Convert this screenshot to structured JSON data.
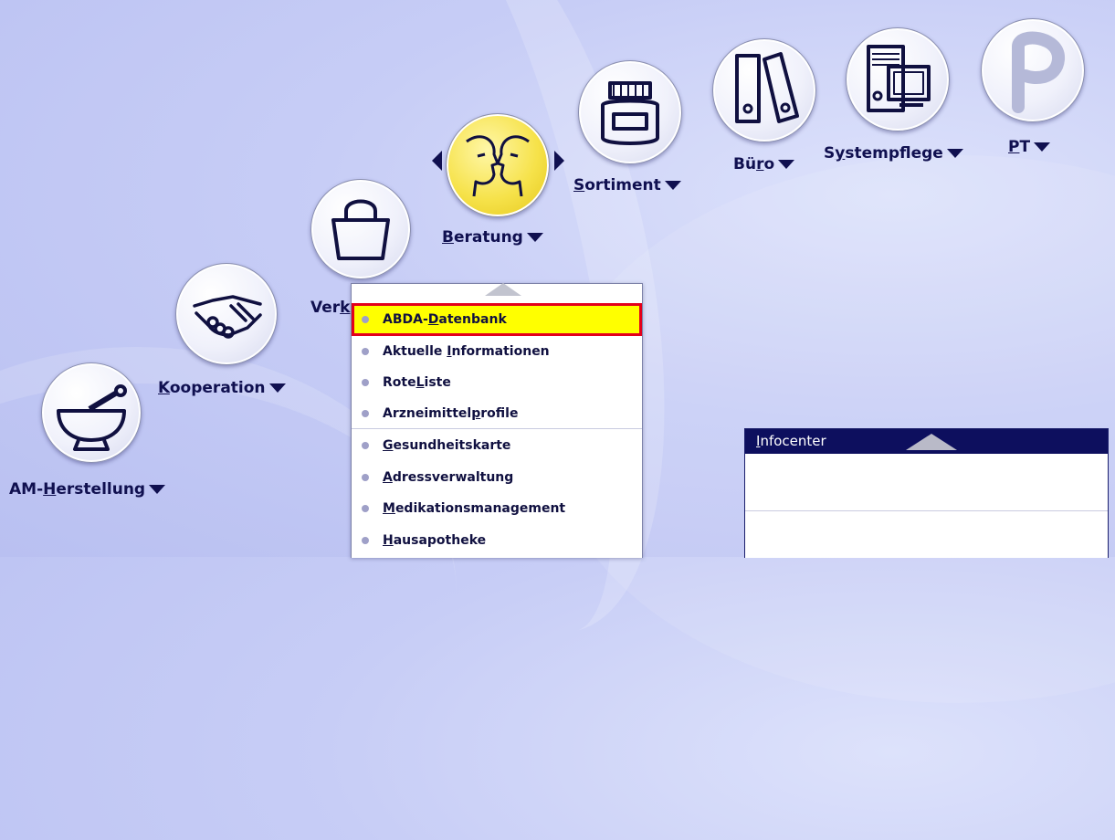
{
  "modules": [
    {
      "id": "am-herstellung",
      "before": "AM-",
      "key": "H",
      "after": "erstellung",
      "icon": "mortar-pestle-icon"
    },
    {
      "id": "kooperation",
      "before": "",
      "key": "K",
      "after": "ooperation",
      "icon": "handshake-icon"
    },
    {
      "id": "verkauf",
      "before": "Ver",
      "key": "k",
      "after": "",
      "icon": "shopping-bag-icon"
    },
    {
      "id": "beratung",
      "before": "",
      "key": "B",
      "after": "eratung",
      "icon": "faces-icon"
    },
    {
      "id": "sortiment",
      "before": "",
      "key": "S",
      "after": "ortiment",
      "icon": "jar-icon"
    },
    {
      "id": "buero",
      "before": "Bü",
      "key": "r",
      "after": "o",
      "icon": "binders-icon"
    },
    {
      "id": "systempflege",
      "before": "S",
      "key": "y",
      "after": "stempflege",
      "icon": "computer-icon"
    },
    {
      "id": "pt",
      "before": "",
      "key": "P",
      "after": "T",
      "icon": "p-logo-icon"
    }
  ],
  "dropdown": {
    "items": [
      {
        "before": "ABDA-",
        "key": "D",
        "after": "atenbank",
        "highlighted": true
      },
      {
        "before": "Aktuelle ",
        "key": "I",
        "after": "nformationen"
      },
      {
        "before": "Rote",
        "key": "L",
        "after": "iste"
      },
      {
        "before": "Arzneimittel",
        "key": "p",
        "after": "rofile"
      },
      {
        "before": "",
        "key": "G",
        "after": "esundheitskarte"
      },
      {
        "before": "",
        "key": "A",
        "after": "dressverwaltung"
      },
      {
        "before": "",
        "key": "M",
        "after": "edikationsmanagement"
      },
      {
        "before": "",
        "key": "H",
        "after": "ausapotheke"
      }
    ]
  },
  "infocenter": {
    "before": "",
    "key": "I",
    "after": "nfocenter"
  },
  "colors": {
    "label": "#101050",
    "highlight": "#ffff00",
    "highlight_border": "#e3001b",
    "infocenter_header": "#0d0f5e"
  }
}
